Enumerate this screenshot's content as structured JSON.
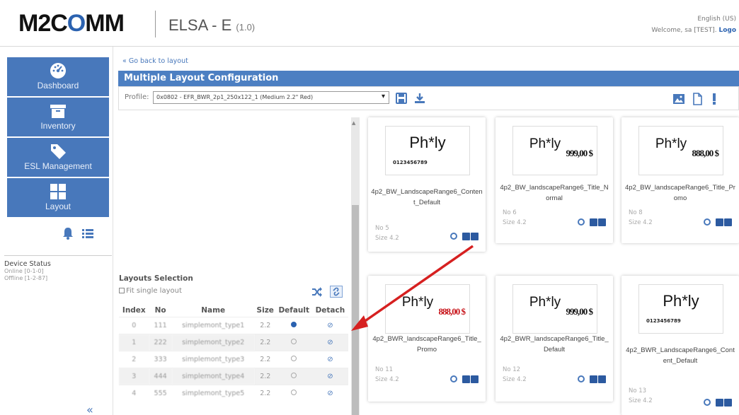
{
  "header": {
    "logo_prefix": "M2C",
    "logo_o": "O",
    "logo_suffix": "MM",
    "app_title": "ELSA - E",
    "app_version": "(1.0)",
    "language": "English (US)",
    "welcome": "Welcome, sa [TEST].",
    "logout": "Logo"
  },
  "sidebar": {
    "items": [
      {
        "label": "Dashboard",
        "icon": "dashboard-icon"
      },
      {
        "label": "Inventory",
        "icon": "inventory-icon"
      },
      {
        "label": "ESL Management",
        "icon": "tag-icon"
      },
      {
        "label": "Layout",
        "icon": "layout-grid-icon"
      }
    ],
    "device_status": {
      "title": "Device Status",
      "online": "Online [0-1-0]",
      "offline": "Offline [1-2-87]"
    },
    "collapse": "«"
  },
  "content": {
    "back_link": "« Go back to layout",
    "section_title": "Multiple Layout Configuration",
    "profile_label": "Profile:",
    "profile_value": "0x0802 - EFR_BWR_2p1_250x122_1 (Medium 2.2\" Red)"
  },
  "selection": {
    "title": "Layouts Selection",
    "fit_single": "Fit single layout",
    "columns": [
      "Index",
      "No",
      "Name",
      "Size",
      "Default",
      "Detach"
    ],
    "rows": [
      {
        "index": "0",
        "no": "111",
        "name": "simplemont_type1",
        "size": "2.2",
        "default": true
      },
      {
        "index": "1",
        "no": "222",
        "name": "simplemont_type2",
        "size": "2.2",
        "default": false
      },
      {
        "index": "2",
        "no": "333",
        "name": "simplemont_type3",
        "size": "2.2",
        "default": false
      },
      {
        "index": "3",
        "no": "444",
        "name": "simplemont_type4",
        "size": "2.2",
        "default": false
      },
      {
        "index": "4",
        "no": "555",
        "name": "simplemont_type5",
        "size": "2.2",
        "default": false
      }
    ]
  },
  "cards": [
    {
      "ph": "Ph*ly",
      "price": "",
      "barcode": "0123456789",
      "name": "4p2_BW_LandscapeRange6_Content_Default",
      "no": "No 5",
      "size": "Size 4.2"
    },
    {
      "ph": "Ph*ly",
      "price": "999,00 $",
      "barcode": "",
      "name": "4p2_BW_landscapeRange6_Title_Normal",
      "no": "No 6",
      "size": "Size 4.2"
    },
    {
      "ph": "Ph*ly",
      "price": "888,00 $",
      "barcode": "",
      "name": "4p2_BW_landscapeRange6_Title_Promo",
      "no": "No 8",
      "size": "Size 4.2"
    },
    {
      "ph": "Ph*ly",
      "price": "888,00 $",
      "barcode": "",
      "name": "4p2_BWR_landscapeRange6_Title_Promo",
      "no": "No 11",
      "size": "Size 4.2",
      "red": true
    },
    {
      "ph": "Ph*ly",
      "price": "999,00 $",
      "barcode": "",
      "name": "4p2_BWR_landscapeRange6_Title_Default",
      "no": "No 12",
      "size": "Size 4.2"
    },
    {
      "ph": "Ph*ly",
      "price": "",
      "barcode": "0123456789",
      "name": "4p2_BWR_LandscapeRange6_Content_Default",
      "no": "No 13",
      "size": "Size 4.2"
    }
  ],
  "colors": {
    "accent": "#4878bb",
    "header_bar": "#4c7fc2",
    "arrow": "#d62020",
    "red_price": "#c8151b"
  }
}
